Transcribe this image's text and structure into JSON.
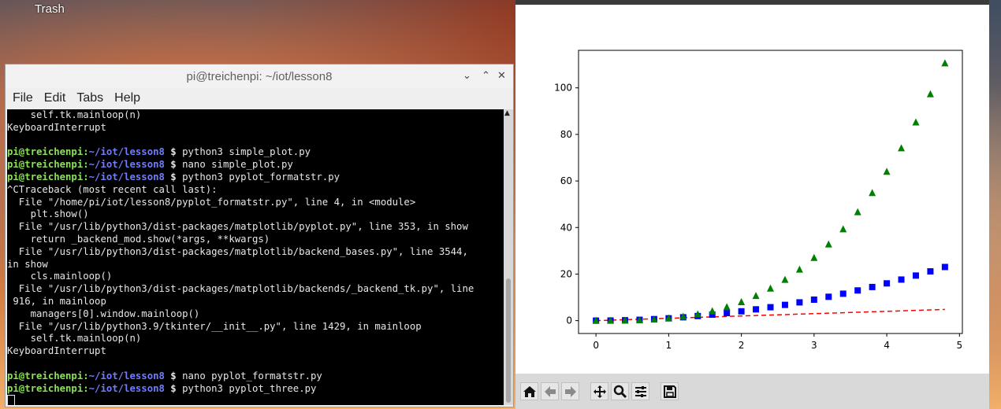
{
  "desktop": {
    "trash_label": "Trash"
  },
  "terminal": {
    "title": "pi@treichenpi: ~/iot/lesson8",
    "controls": {
      "minimize": "⌄",
      "maximize": "⌃",
      "close": "✕"
    },
    "menu": [
      "File",
      "Edit",
      "Tabs",
      "Help"
    ],
    "lines": [
      {
        "type": "text",
        "text": "    self.tk.mainloop(n)"
      },
      {
        "type": "text",
        "text": "KeyboardInterrupt"
      },
      {
        "type": "text",
        "text": ""
      },
      {
        "type": "prompt",
        "user": "pi@treichenpi",
        "path": "~/iot/lesson8",
        "cmd": " python3 simple_plot.py"
      },
      {
        "type": "prompt",
        "user": "pi@treichenpi",
        "path": "~/iot/lesson8",
        "cmd": " nano simple_plot.py"
      },
      {
        "type": "prompt",
        "user": "pi@treichenpi",
        "path": "~/iot/lesson8",
        "cmd": " python3 pyplot_formatstr.py"
      },
      {
        "type": "text",
        "text": "^CTraceback (most recent call last):"
      },
      {
        "type": "text",
        "text": "  File \"/home/pi/iot/lesson8/pyplot_formatstr.py\", line 4, in <module>"
      },
      {
        "type": "text",
        "text": "    plt.show()"
      },
      {
        "type": "text",
        "text": "  File \"/usr/lib/python3/dist-packages/matplotlib/pyplot.py\", line 353, in show"
      },
      {
        "type": "text",
        "text": "    return _backend_mod.show(*args, **kwargs)"
      },
      {
        "type": "text",
        "text": "  File \"/usr/lib/python3/dist-packages/matplotlib/backend_bases.py\", line 3544,"
      },
      {
        "type": "text",
        "text": "in show"
      },
      {
        "type": "text",
        "text": "    cls.mainloop()"
      },
      {
        "type": "text",
        "text": "  File \"/usr/lib/python3/dist-packages/matplotlib/backends/_backend_tk.py\", line"
      },
      {
        "type": "text",
        "text": " 916, in mainloop"
      },
      {
        "type": "text",
        "text": "    managers[0].window.mainloop()"
      },
      {
        "type": "text",
        "text": "  File \"/usr/lib/python3.9/tkinter/__init__.py\", line 1429, in mainloop"
      },
      {
        "type": "text",
        "text": "    self.tk.mainloop(n)"
      },
      {
        "type": "text",
        "text": "KeyboardInterrupt"
      },
      {
        "type": "text",
        "text": ""
      },
      {
        "type": "prompt",
        "user": "pi@treichenpi",
        "path": "~/iot/lesson8",
        "cmd": " nano pyplot_formatstr.py"
      },
      {
        "type": "prompt",
        "user": "pi@treichenpi",
        "path": "~/iot/lesson8",
        "cmd": " python3 pyplot_three.py"
      },
      {
        "type": "cursor"
      }
    ]
  },
  "figure": {
    "toolbar": [
      "home-icon",
      "back-icon",
      "forward-icon",
      "pan-icon",
      "zoom-icon",
      "configure-icon",
      "save-icon"
    ],
    "colors": {
      "red": "#ff0000",
      "blue": "#0000ff",
      "green": "#008000"
    }
  },
  "chart_data": {
    "type": "scatter",
    "x": [
      0,
      0.2,
      0.4,
      0.6,
      0.8,
      1.0,
      1.2,
      1.4,
      1.6,
      1.8,
      2.0,
      2.2,
      2.4,
      2.6,
      2.8,
      3.0,
      3.2,
      3.4,
      3.6,
      3.8,
      4.0,
      4.2,
      4.4,
      4.6,
      4.8
    ],
    "series": [
      {
        "style": "red dashed line",
        "color": "#ff0000",
        "values": [
          0,
          0.2,
          0.4,
          0.6,
          0.8,
          1.0,
          1.2,
          1.4,
          1.6,
          1.8,
          2.0,
          2.2,
          2.4,
          2.6,
          2.8,
          3.0,
          3.2,
          3.4,
          3.6,
          3.8,
          4.0,
          4.2,
          4.4,
          4.6,
          4.8
        ]
      },
      {
        "style": "blue squares",
        "color": "#0000ff",
        "values": [
          0,
          0.04,
          0.16,
          0.36,
          0.64,
          1.0,
          1.44,
          1.96,
          2.56,
          3.24,
          4.0,
          4.84,
          5.76,
          6.76,
          7.84,
          9.0,
          10.24,
          11.56,
          12.96,
          14.44,
          16.0,
          17.64,
          19.36,
          21.16,
          23.04
        ]
      },
      {
        "style": "green triangles",
        "color": "#008000",
        "values": [
          0,
          0.008,
          0.064,
          0.216,
          0.512,
          1.0,
          1.728,
          2.744,
          4.096,
          5.832,
          8.0,
          10.648,
          13.824,
          17.576,
          21.952,
          27.0,
          32.768,
          39.304,
          46.656,
          54.872,
          64.0,
          74.088,
          85.184,
          97.336,
          110.592
        ]
      }
    ],
    "xticks": [
      "0",
      "1",
      "2",
      "3",
      "4",
      "5"
    ],
    "yticks": [
      "0",
      "20",
      "40",
      "60",
      "80",
      "100"
    ],
    "xlim": [
      -0.24,
      5.04
    ],
    "ylim": [
      -5.53,
      116.12
    ],
    "title": "",
    "xlabel": "",
    "ylabel": "",
    "grid": false
  }
}
